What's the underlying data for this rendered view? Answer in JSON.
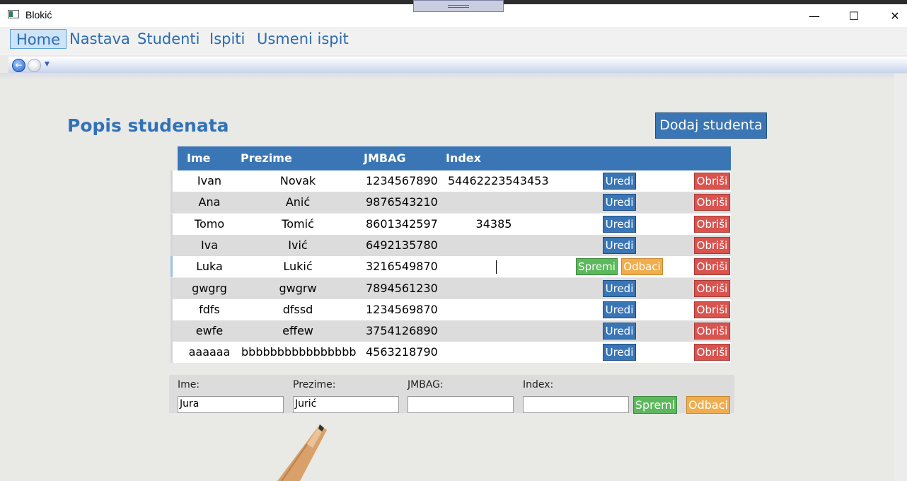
{
  "window": {
    "title": "Blokić",
    "minimize": "—",
    "maximize": "☐",
    "close": "✕"
  },
  "menu": [
    {
      "label": "Home",
      "active": true
    },
    {
      "label": "Nastava"
    },
    {
      "label": "Studenti"
    },
    {
      "label": "Ispiti"
    },
    {
      "label": "Usmeni ispit"
    }
  ],
  "nav": {
    "back_icon": "back-arrow-icon",
    "forward_icon": "forward-arrow-icon"
  },
  "page": {
    "title": "Popis studenata",
    "add_button": "Dodaj studenta"
  },
  "table": {
    "headers": {
      "ime": "Ime",
      "prezime": "Prezime",
      "jmbag": "JMBAG",
      "index": "Index"
    },
    "edit_label": "Uredi",
    "delete_label": "Obriši",
    "save_label": "Spremi",
    "cancel_label": "Odbaci",
    "rows": [
      {
        "ime": "Ivan",
        "prezime": "Novak",
        "jmbag": "1234567890",
        "index": "54462223543453"
      },
      {
        "ime": "Ana",
        "prezime": "Anić",
        "jmbag": "9876543210",
        "index": ""
      },
      {
        "ime": "Tomo",
        "prezime": "Tomić",
        "jmbag": "8601342597",
        "index": "34385"
      },
      {
        "ime": "Iva",
        "prezime": "Ivić",
        "jmbag": "6492135780",
        "index": ""
      },
      {
        "ime": "Luka",
        "prezime": "Lukić",
        "jmbag": "3216549870",
        "index": "",
        "editing": true
      },
      {
        "ime": "gwgrg",
        "prezime": "gwgrw",
        "jmbag": "7894561230",
        "index": ""
      },
      {
        "ime": "fdfs",
        "prezime": "dfssd",
        "jmbag": "1234569870",
        "index": ""
      },
      {
        "ime": "ewfe",
        "prezime": "effew",
        "jmbag": "3754126890",
        "index": ""
      },
      {
        "ime": "aaaaaa",
        "prezime": "bbbbbbbbbbbbbbbb",
        "jmbag": "4563218790",
        "index": ""
      }
    ]
  },
  "form": {
    "ime_label": "Ime:",
    "ime_value": "Jura",
    "prezime_label": "Prezime:",
    "prezime_value": "Jurić",
    "jmbag_label": "JMBAG:",
    "jmbag_value": "",
    "index_label": "Index:",
    "index_value": "",
    "save_label": "Spremi",
    "cancel_label": "Odbaci"
  },
  "colors": {
    "primary": "#3a76b5",
    "danger": "#d9534f",
    "success": "#5cb85c",
    "warning": "#f0ad4e",
    "title": "#3172b7"
  }
}
